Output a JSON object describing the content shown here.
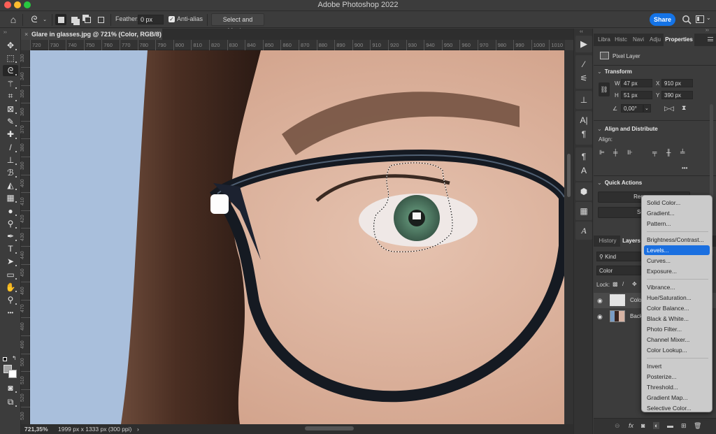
{
  "window": {
    "app_title": "Adobe Photoshop 2022",
    "traffic_lights": {
      "close": "#fe5f57",
      "minimize": "#febc2e",
      "zoom": "#28c840"
    }
  },
  "options_bar": {
    "home_icon": "home-icon",
    "tool_icon": "lasso-icon",
    "selection_modes": [
      "new-selection",
      "add-to-selection",
      "subtract-from-selection",
      "intersect-with-selection"
    ],
    "feather_label": "Feather:",
    "feather_value": "0 px",
    "anti_alias_label": "Anti-alias",
    "anti_alias_checked": true,
    "select_and_mask_label": "Select and Mask...",
    "share_label": "Share",
    "share_color": "#1473e6"
  },
  "document_tab": {
    "close_glyph": "×",
    "title": "Glare in glasses.jpg @ 721% (Color, RGB/8) *"
  },
  "toolbar": {
    "tools": [
      {
        "name": "move-tool",
        "glyph": "✥"
      },
      {
        "name": "marquee-tool",
        "glyph": "⬚"
      },
      {
        "name": "lasso-tool",
        "glyph": "ᘓ",
        "active": true
      },
      {
        "name": "magic-wand-tool",
        "glyph": "⚚"
      },
      {
        "name": "crop-tool",
        "glyph": "⌗"
      },
      {
        "name": "frame-tool",
        "glyph": "⊠"
      },
      {
        "name": "eyedropper-tool",
        "glyph": "✎"
      },
      {
        "name": "healing-brush-tool",
        "glyph": "✚"
      },
      {
        "name": "brush-tool",
        "glyph": "/"
      },
      {
        "name": "clone-stamp-tool",
        "glyph": "⊥"
      },
      {
        "name": "history-brush-tool",
        "glyph": "ℬ"
      },
      {
        "name": "eraser-tool",
        "glyph": "◭"
      },
      {
        "name": "gradient-tool",
        "glyph": "▦"
      },
      {
        "name": "blur-tool",
        "glyph": "●"
      },
      {
        "name": "dodge-tool",
        "glyph": "⚲"
      },
      {
        "name": "pen-tool",
        "glyph": "✒"
      },
      {
        "name": "type-tool",
        "glyph": "T"
      },
      {
        "name": "path-selection-tool",
        "glyph": "➤"
      },
      {
        "name": "rectangle-tool",
        "glyph": "▭"
      },
      {
        "name": "hand-tool",
        "glyph": "✋"
      },
      {
        "name": "zoom-tool",
        "glyph": "⚲"
      },
      {
        "name": "more-tools",
        "glyph": "•••"
      }
    ],
    "bottom_tools": [
      {
        "name": "quick-mask-tool",
        "glyph": "◙"
      },
      {
        "name": "screen-mode-tool",
        "glyph": "⧉"
      }
    ],
    "foreground_color": "#a6a6a6",
    "background_color": "#ffffff"
  },
  "rulers": {
    "horizontal": [
      "720",
      "730",
      "740",
      "750",
      "760",
      "770",
      "780",
      "790",
      "800",
      "810",
      "820",
      "830",
      "840",
      "850",
      "860",
      "870",
      "880",
      "890",
      "900",
      "910",
      "920",
      "930",
      "940",
      "950",
      "960",
      "970",
      "980",
      "990",
      "1000",
      "1010"
    ],
    "vertical": [
      "330",
      "340",
      "350",
      "360",
      "370",
      "380",
      "390",
      "400",
      "410",
      "420",
      "430",
      "440",
      "450",
      "460",
      "470",
      "480",
      "490",
      "500",
      "510",
      "520",
      "530"
    ]
  },
  "status_bar": {
    "zoom": "721,35%",
    "doc_info": "1999 px x 1333 px (300 ppi)",
    "arrow": "›"
  },
  "dock": {
    "groups": [
      [
        "play-icon"
      ],
      [
        "brush-settings-icon",
        "brush-presets-icon"
      ],
      [
        "clone-source-icon"
      ],
      [
        "character-icon",
        "paragraph-icon"
      ],
      [
        "character-styles-icon",
        "paragraph-styles-icon"
      ],
      [
        "3d-icon"
      ],
      [
        "grid-icon"
      ],
      [
        "glyphs-icon"
      ]
    ]
  },
  "properties_panel": {
    "tabs": [
      "Libra",
      "Histc",
      "Navi",
      "Adju",
      "Properties"
    ],
    "active_tab": "Properties",
    "layer_type": "Pixel Layer",
    "transform": {
      "title": "Transform",
      "w_label": "W",
      "w_value": "47 px",
      "h_label": "H",
      "h_value": "51 px",
      "x_label": "X",
      "x_value": "910 px",
      "y_label": "Y",
      "y_value": "390 px",
      "angle_value": "0,00°"
    },
    "align": {
      "title": "Align and Distribute",
      "label": "Align:",
      "more": "•••"
    },
    "quick_actions": {
      "title": "Quick Actions",
      "buttons": [
        "Remove Background",
        "Select Subject"
      ],
      "visible_text": [
        "Remove",
        "Selec"
      ]
    }
  },
  "layers_panel": {
    "tabs": [
      "History",
      "Layers"
    ],
    "active_tab": "Layers",
    "filter_kind": "Kind",
    "blend_mode": "Color",
    "lock_label": "Lock:",
    "layers": [
      {
        "name": "Colo",
        "visible": true,
        "selected": true,
        "thumb": "#e4e4e4"
      },
      {
        "name": "Back",
        "visible": true,
        "selected": false,
        "thumb": "#7a9cc4"
      }
    ],
    "footer_icons": [
      "link-layers-icon",
      "fx-icon",
      "add-mask-icon",
      "adjustment-layer-icon",
      "group-icon",
      "new-layer-icon",
      "delete-layer-icon"
    ]
  },
  "adjustment_menu": {
    "groups": [
      [
        "Solid Color...",
        "Gradient...",
        "Pattern..."
      ],
      [
        "Brightness/Contrast...",
        "Levels...",
        "Curves...",
        "Exposure..."
      ],
      [
        "Vibrance...",
        "Hue/Saturation...",
        "Color Balance...",
        "Black & White...",
        "Photo Filter...",
        "Channel Mixer...",
        "Color Lookup..."
      ],
      [
        "Invert",
        "Posterize...",
        "Threshold...",
        "Gradient Map...",
        "Selective Color..."
      ]
    ],
    "highlighted": "Levels...",
    "highlight_color": "#1a6fe0"
  }
}
